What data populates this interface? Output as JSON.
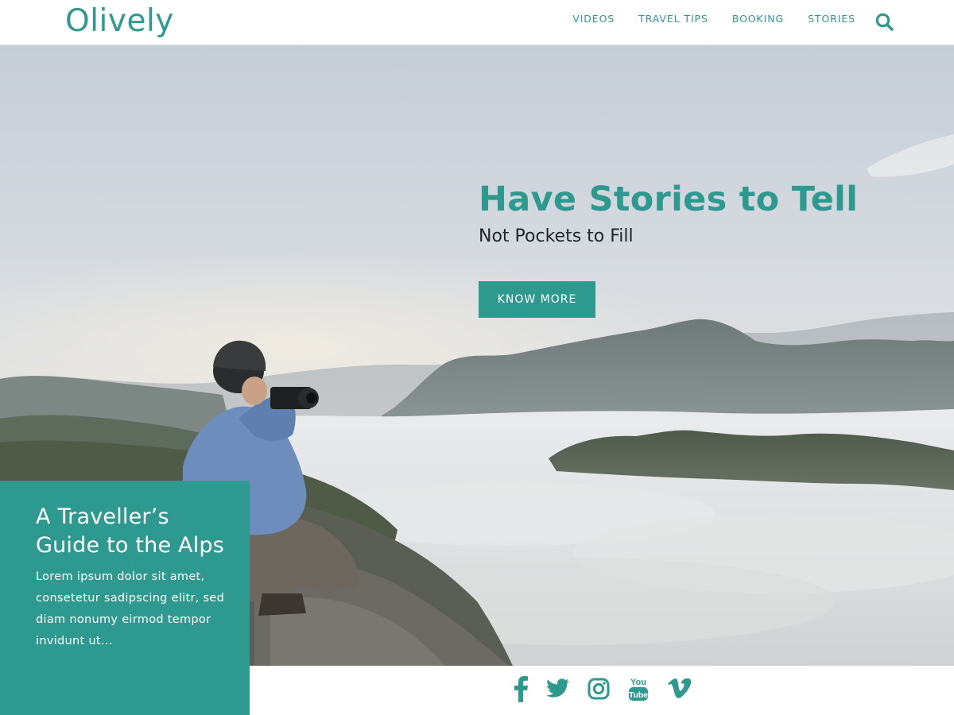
{
  "brand": {
    "name": "Olively",
    "accent_color": "#2e9a8f",
    "text_color": "#222628"
  },
  "nav": {
    "items": [
      {
        "label": "VIDEOS"
      },
      {
        "label": "TRAVEL TIPS"
      },
      {
        "label": "BOOKING"
      },
      {
        "label": "STORIES"
      }
    ],
    "search_icon": "search-icon"
  },
  "hero": {
    "title": "Have Stories to Tell",
    "subtitle": "Not Pockets to Fill",
    "cta_label": "KNOW MORE",
    "background": "photographer-on-mountain-cliff-above-clouds"
  },
  "feature": {
    "title": "A Traveller’s Guide to the Alps",
    "excerpt": "Lorem ipsum dolor sit amet, consetetur sadipscing elitr, sed diam nonumy eirmod tempor invidunt ut…"
  },
  "social": {
    "icons": [
      "facebook-icon",
      "twitter-icon",
      "instagram-icon",
      "youtube-icon",
      "vimeo-icon"
    ]
  }
}
